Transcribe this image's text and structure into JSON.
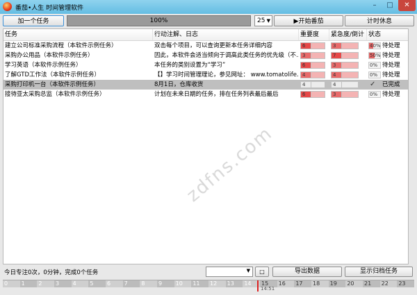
{
  "window": {
    "title": "番茄•人生 时间管理软件",
    "minimize": "–",
    "maximize": "□",
    "close": "✕"
  },
  "toolbar": {
    "add_task": "加一个任务",
    "progress_text": "100%",
    "progress_value": 1.0,
    "pomodoro_minutes": "25",
    "start_label": "▶开始番茄",
    "rest_label": "计时休息"
  },
  "columns": {
    "task": "任务",
    "action": "行动注解、日志",
    "importance": "重要度",
    "urgency": "紧急度/倒计",
    "status": "状态"
  },
  "tasks": [
    {
      "task": "建立公司标准采购流程（本软件示例任务）",
      "action": "双击每个项目，可以查询更新本任务详细内容",
      "importance": 6,
      "urgency": 3,
      "progress": "40%",
      "progress_value": 0.4,
      "status": "待处理",
      "selected": false
    },
    {
      "task": "采购办公用品（本软件示例任务）",
      "action": "因此，本软件会适当倾向于调高此类任务的优先级（不…",
      "importance": 3,
      "urgency": 7,
      "progress": "50%",
      "progress_value": 0.5,
      "status": "待处理",
      "selected": false
    },
    {
      "task": "学习英语（本软件示例任务）",
      "action": "本任务的类别设置为“学习”",
      "importance": 6,
      "urgency": 3,
      "progress": "0%",
      "progress_value": 0.0,
      "status": "待处理",
      "selected": false
    },
    {
      "task": "了解GTD工作法（本软件示例任务）",
      "action": "【】学习时间管理理论，参见网址： www.tomatolife.c…",
      "importance": 4,
      "urgency": 4,
      "progress": "0%",
      "progress_value": 0.0,
      "status": "待处理",
      "selected": false
    },
    {
      "task": "采购打印机一台（本软件示例任务）",
      "action": "8月1日，仓库收货",
      "importance": 4,
      "urgency": 4,
      "progress": "",
      "progress_value": null,
      "status": "已完成",
      "selected": true
    },
    {
      "task": "接待亚太采购总监（本软件示例任务）",
      "action": "计划在未来日期的任务，排在任务列表最后最后",
      "importance": 6,
      "urgency": 3,
      "progress": "0%",
      "progress_value": 0.0,
      "status": "待处理",
      "selected": false
    }
  ],
  "colors": {
    "importance_high": "#e64848",
    "importance_low": "#f4b3b3",
    "selected_row": "#bfbfbf",
    "titlebar": "#64bde3"
  },
  "icons": {
    "check": "✓",
    "dropdown": "▼"
  },
  "watermark": "zdfns.com",
  "footer": {
    "focus_info": "今日专注0次，0分钟，完成0个任务",
    "square_button": "□",
    "export": "导出数据",
    "show_archive": "显示归档任务"
  },
  "timeline": {
    "hours": [
      "0",
      "1",
      "2",
      "3",
      "4",
      "5",
      "6",
      "7",
      "8",
      "9",
      "10",
      "11",
      "12",
      "13",
      "14",
      "15",
      "16",
      "17",
      "18",
      "19",
      "20",
      "21",
      "22",
      "23"
    ],
    "current_time": "14:51"
  }
}
